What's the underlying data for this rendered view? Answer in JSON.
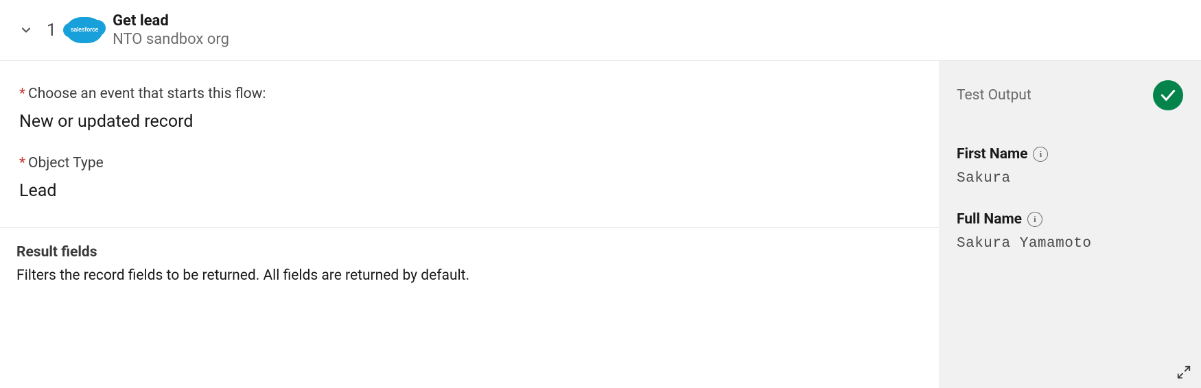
{
  "header": {
    "step_number": "1",
    "title": "Get lead",
    "subtitle": "NTO sandbox org",
    "badge_text": "salesforce"
  },
  "main": {
    "event_label": "Choose an event that starts this flow:",
    "event_value": "New or updated record",
    "object_type_label": "Object Type",
    "object_type_value": "Lead",
    "result_fields_heading": "Result fields",
    "result_fields_desc": "Filters the record fields to be returned. All fields are returned by default."
  },
  "side": {
    "panel_label": "Test Output",
    "outputs": [
      {
        "name": "First Name",
        "value": "Sakura"
      },
      {
        "name": "Full Name",
        "value": "Sakura Yamamoto"
      }
    ]
  }
}
